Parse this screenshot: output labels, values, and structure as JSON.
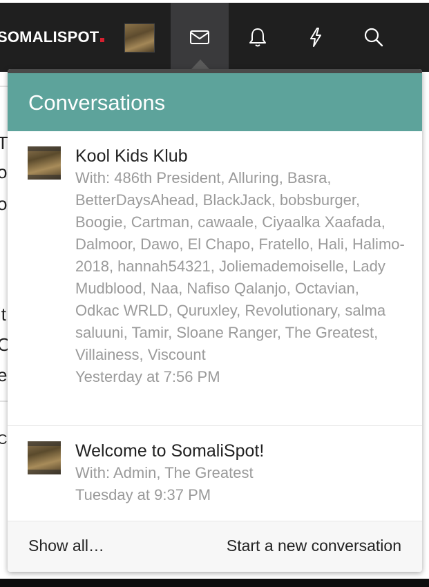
{
  "header": {
    "logo_text": "SOMALISPOT",
    "logo_dot_color": "#d6202f",
    "nav_icons": [
      "envelope-icon",
      "bell-icon",
      "lightning-icon",
      "search-icon"
    ],
    "active_icon": "envelope-icon"
  },
  "panel": {
    "title": "Conversations",
    "header_color": "#5da39b",
    "conversations": [
      {
        "title": "Kool Kids Klub",
        "participants": "With: 486th President, Alluring, Basra, BetterDaysAhead, BlackJack, bobsburger, Boogie, Cartman, cawaale, Ciyaalka Xaafada, Dalmoor, Dawo, El Chapo, Fratello, Hali, Halimo-2018, hannah54321, Joliemademoiselle, Lady Mudblood, Naa, Nafiso Qalanjo, Octavian, Odkac WRLD, Quruxley, Revolutionary, salma saluuni, Tamir, Sloane Ranger, The Greatest, Villainess, Viscount",
        "time": "Yesterday at 7:56 PM"
      },
      {
        "title": "Welcome to SomaliSpot!",
        "participants": "With: Admin, The Greatest",
        "time": "Tuesday at 9:37 PM"
      }
    ],
    "footer": {
      "show_all": "Show all…",
      "new_conversation": "Start a new conversation"
    }
  },
  "background_fragments": [
    "T",
    "o",
    "o",
    "it",
    "O",
    "e",
    "C"
  ]
}
